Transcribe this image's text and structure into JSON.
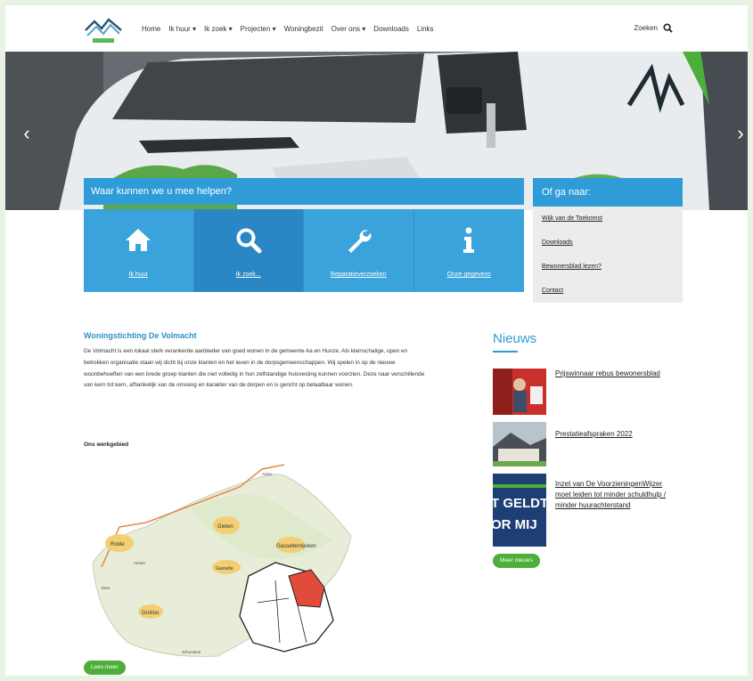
{
  "nav": {
    "menu": [
      "Home",
      "Ik huur ▾",
      "Ik zoek ▾",
      "Projecten ▾",
      "Woningbezit",
      "Over ons ▾",
      "Downloads",
      "Links"
    ],
    "search_label": "Zoeken"
  },
  "help": {
    "title": "Waar kunnen we u mee helpen?",
    "tiles": [
      {
        "label": "Ik huur",
        "icon": "home-icon"
      },
      {
        "label": "Ik zoek...",
        "icon": "search-icon"
      },
      {
        "label": "Reparatieverzoeken",
        "icon": "wrench-icon"
      },
      {
        "label": "Onze gegevens",
        "icon": "info-icon"
      }
    ]
  },
  "goto": {
    "title": "Of ga naar:",
    "links": [
      "Wijk van de Toekomst",
      "Downloads",
      "Bewonersblad lezen?",
      "Contact"
    ]
  },
  "main": {
    "title": "Woningstichting De Volmacht",
    "text": "De Volmacht is een lokaal sterk verankerde aanbieder van goed wonen in de gemeente Aa en Hunze. Als kleinschalige, open en betrokken organisatie staan wij dicht bij onze klanten en het leven in de dorpsgemeenschappen. Wij spelen in op de nieuwe woonbehoeften van een brede groep klanten die niet volledig in hun zelfstandige huisvesting kunnen voorzien. Deze naar verschillende van kern tot kern, afhankelijk van de omvang en karakter van de dorpen en is gericht op betaalbaar wonen.",
    "region_label": "Ons werkgebied",
    "read_more": "Lees meer",
    "map_places": [
      "Rolde",
      "Gieten",
      "Grolloo",
      "Gasselternijveen",
      "Gasselte",
      "Annen",
      "Eext",
      "Schoonloo",
      "Anloo"
    ]
  },
  "news": {
    "title": "Nieuws",
    "items": [
      {
        "title": "Prijswinnaar rebus bewonersblad"
      },
      {
        "title": "Prestatieafspraken 2022"
      },
      {
        "title": "Inzet van De VoorzieningenWijzer moet leiden tot minder schuldhulp / minder huurachterstand"
      }
    ],
    "more": "Meer nieuws",
    "thumb3_text_1": "T GELDT",
    "thumb3_text_2": "OR MIJ"
  }
}
